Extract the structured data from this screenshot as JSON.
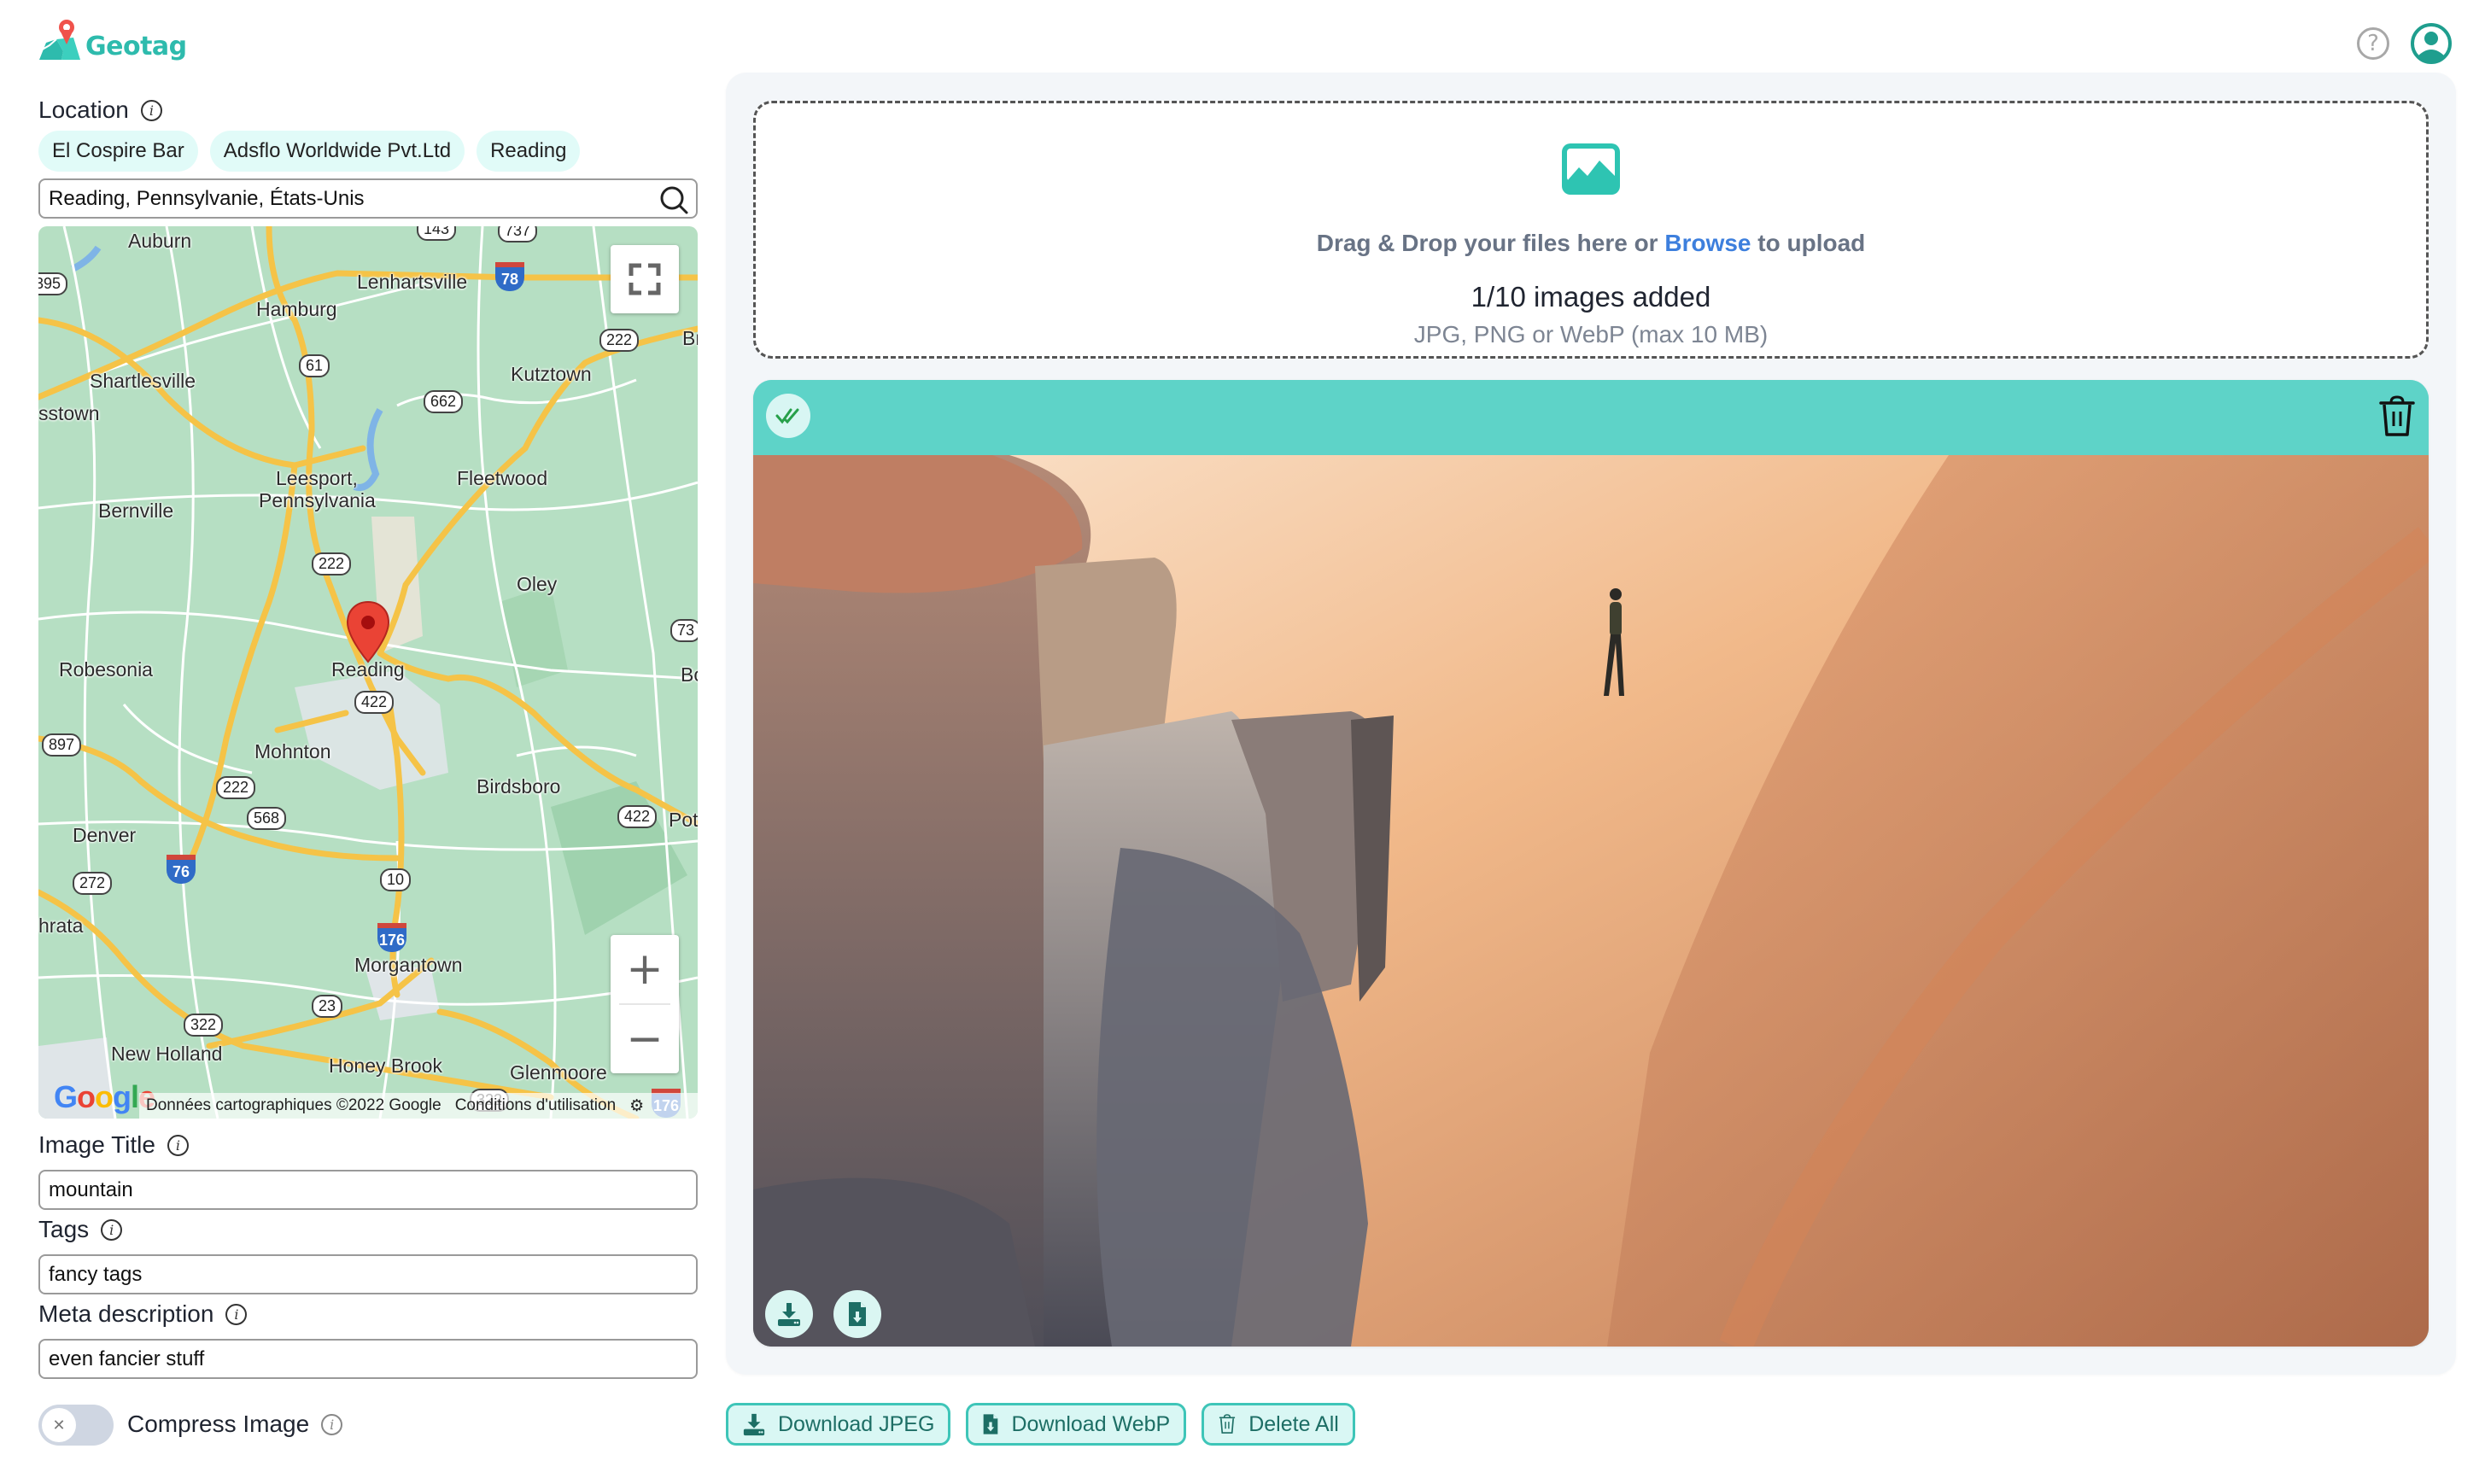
{
  "app": {
    "name": "Geotag",
    "brand_color": "#2ebbad",
    "pin_color": "#f0524b"
  },
  "header": {
    "help_icon": "help-circle-icon",
    "user_icon": "user-circle-icon"
  },
  "location": {
    "label": "Location",
    "chips": [
      "El Cospire Bar",
      "Adsflo Worldwide Pvt.Ltd",
      "Reading"
    ],
    "search_value": "Reading, Pennsylvanie, États-Unis",
    "search_icon": "search-icon"
  },
  "map": {
    "places": [
      {
        "name": "Auburn"
      },
      {
        "name": "Lenhartsville"
      },
      {
        "name": "Hamburg"
      },
      {
        "name": "Shartlesville"
      },
      {
        "name": "sstown"
      },
      {
        "name": "Kutztown"
      },
      {
        "name": "Leesport,"
      },
      {
        "name": "Pennsylvania"
      },
      {
        "name": "Fleetwood"
      },
      {
        "name": "Bernville"
      },
      {
        "name": "Oley"
      },
      {
        "name": "Robesonia"
      },
      {
        "name": "Reading"
      },
      {
        "name": "Mohnton"
      },
      {
        "name": "Birdsboro"
      },
      {
        "name": "Denver"
      },
      {
        "name": "hrata"
      },
      {
        "name": "Morgantown"
      },
      {
        "name": "New Holland"
      },
      {
        "name": "Honey Brook"
      },
      {
        "name": "Glenmoore"
      },
      {
        "name": "Bo"
      },
      {
        "name": "Pot"
      },
      {
        "name": "Br"
      }
    ],
    "route_shields": [
      "143",
      "737",
      "395",
      "222",
      "61",
      "662",
      "222",
      "73",
      "422",
      "897",
      "222",
      "568",
      "422",
      "272",
      "10",
      "23",
      "322",
      "322"
    ],
    "interstates": [
      "78",
      "76",
      "176",
      "176"
    ],
    "attribution": "Données cartographiques ©2022 Google",
    "terms": "Conditions d'utilisation",
    "google_logo": "Google",
    "zoom_in": "+",
    "zoom_out": "−"
  },
  "fields": {
    "image_title": {
      "label": "Image Title",
      "value": "mountain"
    },
    "tags": {
      "label": "Tags",
      "value": "fancy tags"
    },
    "meta_description": {
      "label": "Meta description",
      "value": "even fancier stuff"
    },
    "compress": {
      "label": "Compress Image",
      "enabled": false
    }
  },
  "upload": {
    "drag_text_before": "Drag & Drop your files here or ",
    "browse_link": "Browse",
    "drag_text_after": " to upload",
    "count_text": "1/10 images added",
    "formats_text": "JPG, PNG or WebP (max 10 MB)",
    "accent": "#3d7fdd"
  },
  "image_card": {
    "status_icon": "double-check-icon",
    "delete_icon": "trash-icon",
    "download_jpeg_icon": "download-icon",
    "download_webp_icon": "file-download-icon",
    "header_color": "#5ed3c8"
  },
  "actions": {
    "download_jpeg": "Download JPEG",
    "download_webp": "Download WebP",
    "delete_all": "Delete All"
  }
}
